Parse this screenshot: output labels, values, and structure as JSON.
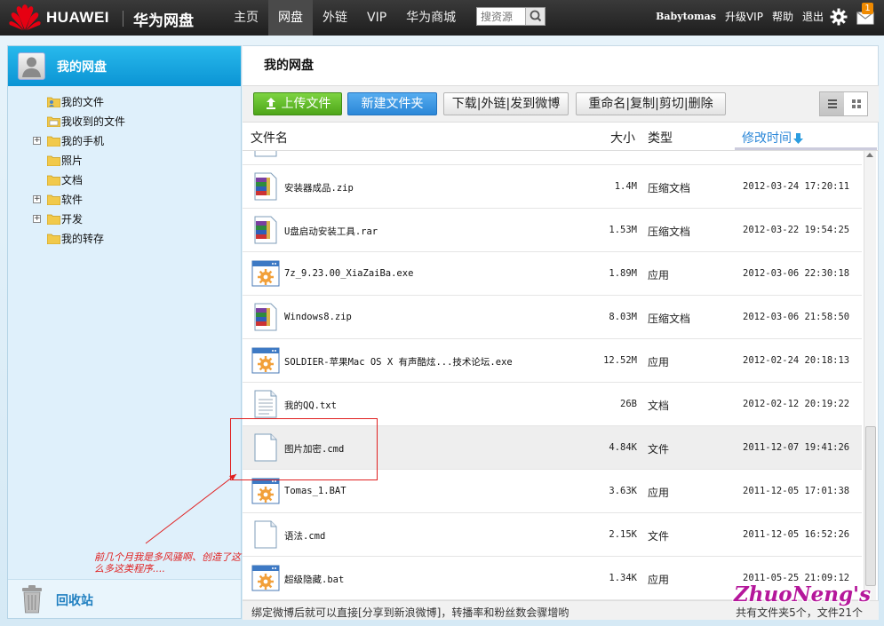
{
  "header": {
    "brand": "HUAWEI",
    "product": "华为网盘",
    "nav": [
      {
        "label": "主页",
        "active": false
      },
      {
        "label": "网盘",
        "active": true
      },
      {
        "label": "外链",
        "active": false
      },
      {
        "label": "VIP",
        "active": false
      },
      {
        "label": "华为商城",
        "active": false
      }
    ],
    "search_placeholder": "搜资源",
    "username": "Babytomas",
    "upgrade_vip": "升级VIP",
    "help": "帮助",
    "logout": "退出",
    "mail_count": "1",
    "accent_color": "#c8102e"
  },
  "sidebar": {
    "title": "我的网盘",
    "items": [
      {
        "label": "我的文件",
        "expandable": false,
        "icon": "user-folder-icon"
      },
      {
        "label": "我收到的文件",
        "expandable": false,
        "icon": "inbox-folder-icon"
      },
      {
        "label": "我的手机",
        "expandable": true,
        "icon": "folder-icon"
      },
      {
        "label": "照片",
        "expandable": false,
        "icon": "folder-icon"
      },
      {
        "label": "文档",
        "expandable": false,
        "icon": "folder-icon"
      },
      {
        "label": "软件",
        "expandable": true,
        "icon": "folder-icon"
      },
      {
        "label": "开发",
        "expandable": true,
        "icon": "folder-icon"
      },
      {
        "label": "我的转存",
        "expandable": false,
        "icon": "folder-icon"
      }
    ],
    "recycle_bin": "回收站"
  },
  "main": {
    "title": "我的网盘",
    "toolbar": {
      "upload": "上传文件",
      "new_folder": "新建文件夹",
      "group1": "下载|外链|发到微博",
      "group2": "重命名|复制|剪切|删除"
    },
    "columns": {
      "name": "文件名",
      "size": "大小",
      "type": "类型",
      "modified": "修改时间"
    },
    "files": [
      {
        "name": "安装器成品.zip",
        "size": "1.4M",
        "type": "压缩文档",
        "date": "2012-03-24 17:20:11",
        "icon": "archive"
      },
      {
        "name": "U盘启动安装工具.rar",
        "size": "1.53M",
        "type": "压缩文档",
        "date": "2012-03-22 19:54:25",
        "icon": "archive"
      },
      {
        "name": "7z_9.23.00_XiaZaiBa.exe",
        "size": "1.89M",
        "type": "应用",
        "date": "2012-03-06 22:30:18",
        "icon": "app"
      },
      {
        "name": "Windows8.zip",
        "size": "8.03M",
        "type": "压缩文档",
        "date": "2012-03-06 21:58:50",
        "icon": "archive"
      },
      {
        "name": "SOLDIER-苹果Mac OS X 有声酷炫...技术论坛.exe",
        "size": "12.52M",
        "type": "应用",
        "date": "2012-02-24 20:18:13",
        "icon": "app"
      },
      {
        "name": "我的QQ.txt",
        "size": "26B",
        "type": "文档",
        "date": "2012-02-12 20:19:22",
        "icon": "text"
      },
      {
        "name": "图片加密.cmd",
        "size": "4.84K",
        "type": "文件",
        "date": "2011-12-07 19:41:26",
        "icon": "blank"
      },
      {
        "name": "Tomas_1.BAT",
        "size": "3.63K",
        "type": "应用",
        "date": "2011-12-05 17:01:38",
        "icon": "app"
      },
      {
        "name": "语法.cmd",
        "size": "2.15K",
        "type": "文件",
        "date": "2011-12-05 16:52:26",
        "icon": "blank"
      },
      {
        "name": "超级隐藏.bat",
        "size": "1.34K",
        "type": "应用",
        "date": "2011-05-25 21:09:12",
        "icon": "app"
      }
    ],
    "status_left": "绑定微博后就可以直接[分享到新浪微博]，转播率和粉丝数会骤增哟",
    "status_right": "共有文件夹5个，文件21个"
  },
  "annotation": {
    "text": "前几个月我是多风骚啊、创造了这么多这类程序....",
    "color": "#e02020"
  },
  "watermark": "ZhuoNeng's"
}
